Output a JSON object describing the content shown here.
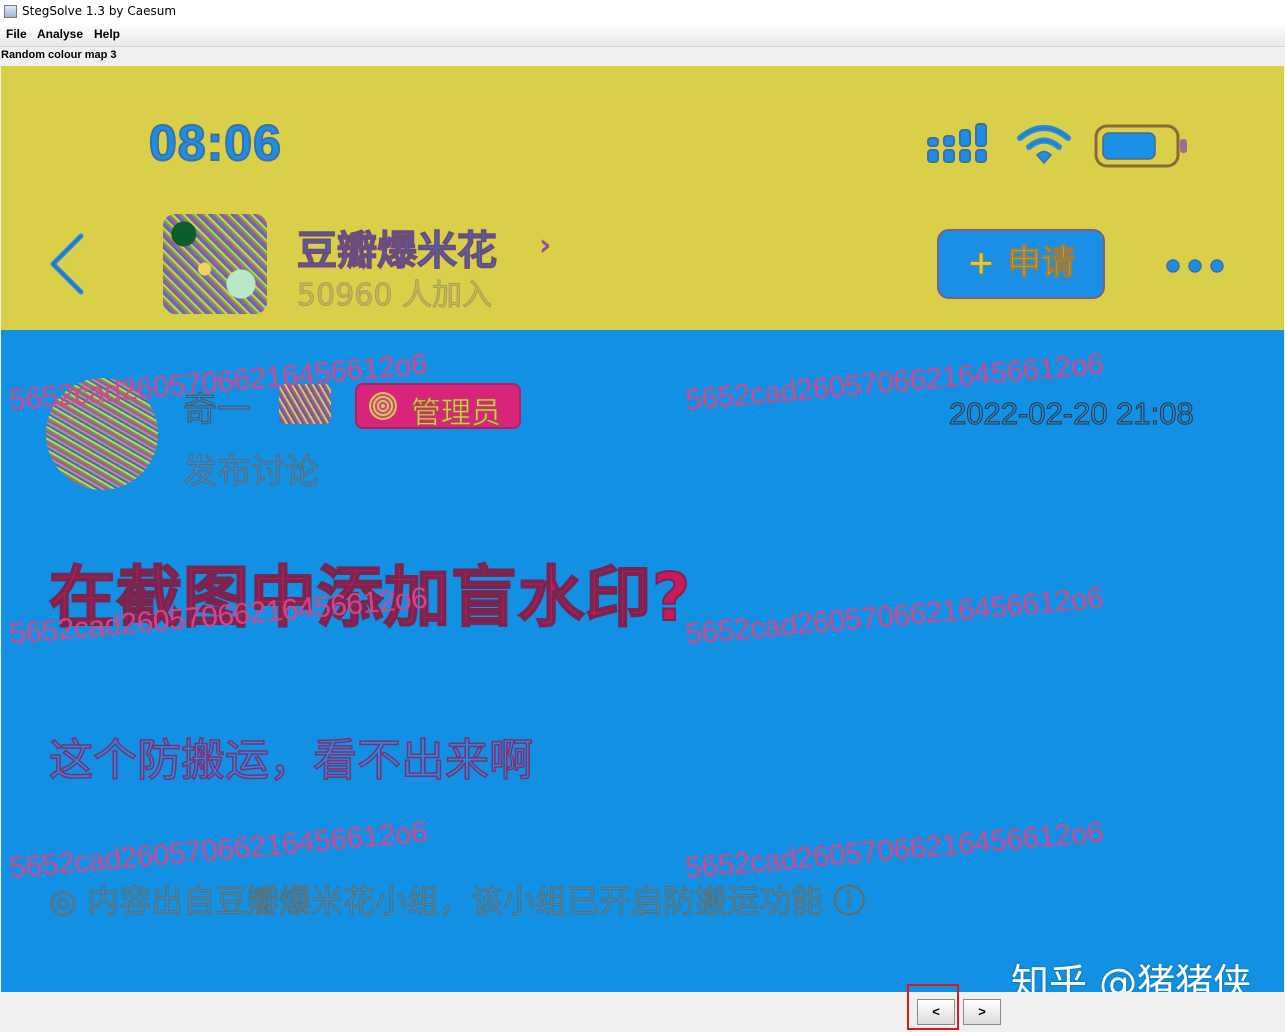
{
  "window": {
    "title": "StegSolve 1.3 by Caesum"
  },
  "menu": [
    "File",
    "Analyse",
    "Help"
  ],
  "mode_label": "Random colour map 3",
  "screenshot": {
    "status_bar": {
      "time": "08:06"
    },
    "group": {
      "name": "豆瓣爆米花",
      "chevron": "›",
      "members": "50960 人加入",
      "apply_label": "+ 申请"
    },
    "post": {
      "author": "奇一",
      "badge": "管理员",
      "timestamp": "2022-02-20 21:08",
      "type": "发布讨论",
      "title": "在截图中添加盲水印?",
      "body": "这个防搬运，看不出来啊",
      "footer": "◎ 内容出自豆瓣爆米花小组，该小组已开启防搬运功能 ⓘ"
    },
    "watermark_text": "5652cad26057066216456612o6",
    "site_watermark": "知乎 @猪猪侠"
  },
  "colors": {
    "header_bg": "#d9cf48",
    "body_bg": "#1190e4",
    "accent_blue": "#1b8fe6",
    "watermark_pink": "#d8468a",
    "badge_pink": "#d8257b",
    "highlight_red": "#e01818"
  },
  "nav": {
    "prev_label": "<",
    "next_label": ">"
  }
}
